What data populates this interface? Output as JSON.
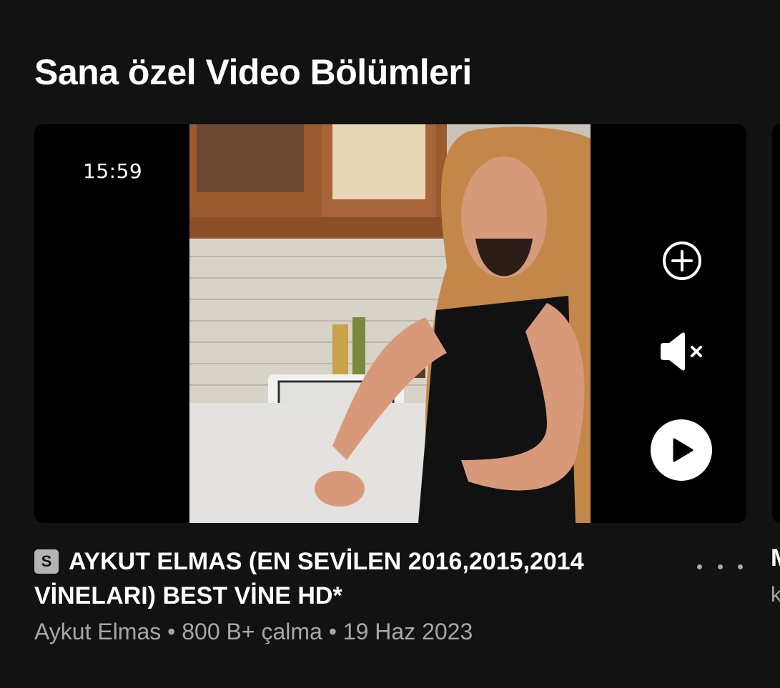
{
  "section": {
    "title": "Sana özel Video Bölümleri"
  },
  "card": {
    "duration": "15:59",
    "badge": "S",
    "title": "AYKUT ELMAS (EN SEVİLEN 2016,2015,2014 VİNELARI) BEST VİNE HD*",
    "artist": "Aykut Elmas",
    "plays": "800 B+ çalma",
    "date": "19 Haz 2023",
    "separator": "•",
    "actions": {
      "add_icon": "add-circle-icon",
      "mute_icon": "speaker-muted-icon",
      "play_icon": "play-icon",
      "more_icon": "more-dots-icon"
    }
  },
  "peek": {
    "title_start": "M",
    "subtitle_start": "k"
  },
  "colors": {
    "background": "#121212",
    "text_primary": "#ffffff",
    "text_secondary": "#a7a7a7",
    "badge": "#b3b3b3"
  }
}
